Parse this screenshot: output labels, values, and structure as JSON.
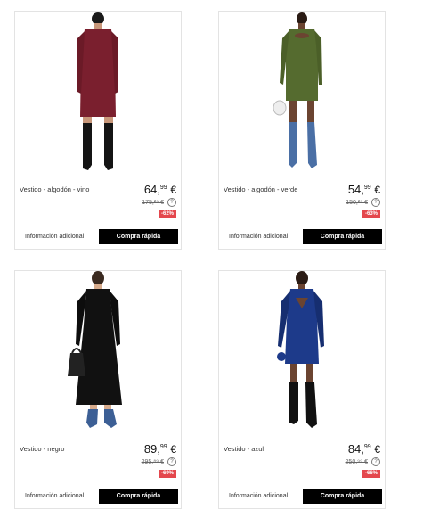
{
  "products": [
    {
      "name": "Vestido - algodón - vino",
      "price_int": "64,",
      "price_cents": "99",
      "currency": "€",
      "old_price": "175,²⁹ €",
      "discount": "-62%",
      "more_info_label": "Información adicional",
      "quick_buy_label": "Compra rápida",
      "dress_color": "#7a1f2e"
    },
    {
      "name": "Vestido - algodón - verde",
      "price_int": "54,",
      "price_cents": "99",
      "currency": "€",
      "old_price": "150,²⁹ €",
      "discount": "-63%",
      "more_info_label": "Información adicional",
      "quick_buy_label": "Compra rápida",
      "dress_color": "#556b2f"
    },
    {
      "name": "Vestido - negro",
      "price_int": "89,",
      "price_cents": "99",
      "currency": "€",
      "old_price": "295,⁸⁹ €",
      "discount": "-69%",
      "more_info_label": "Información adicional",
      "quick_buy_label": "Compra rápida",
      "dress_color": "#111111"
    },
    {
      "name": "Vestido - azul",
      "price_int": "84,",
      "price_cents": "99",
      "currency": "€",
      "old_price": "250,⁹⁹ €",
      "discount": "-66%",
      "more_info_label": "Información adicional",
      "quick_buy_label": "Compra rápida",
      "dress_color": "#1d3a8a"
    }
  ],
  "colors": {
    "discount_bg": "#e4474d",
    "button_bg": "#000000",
    "border": "#e3e3e3"
  },
  "info_icon_glyph": "?"
}
